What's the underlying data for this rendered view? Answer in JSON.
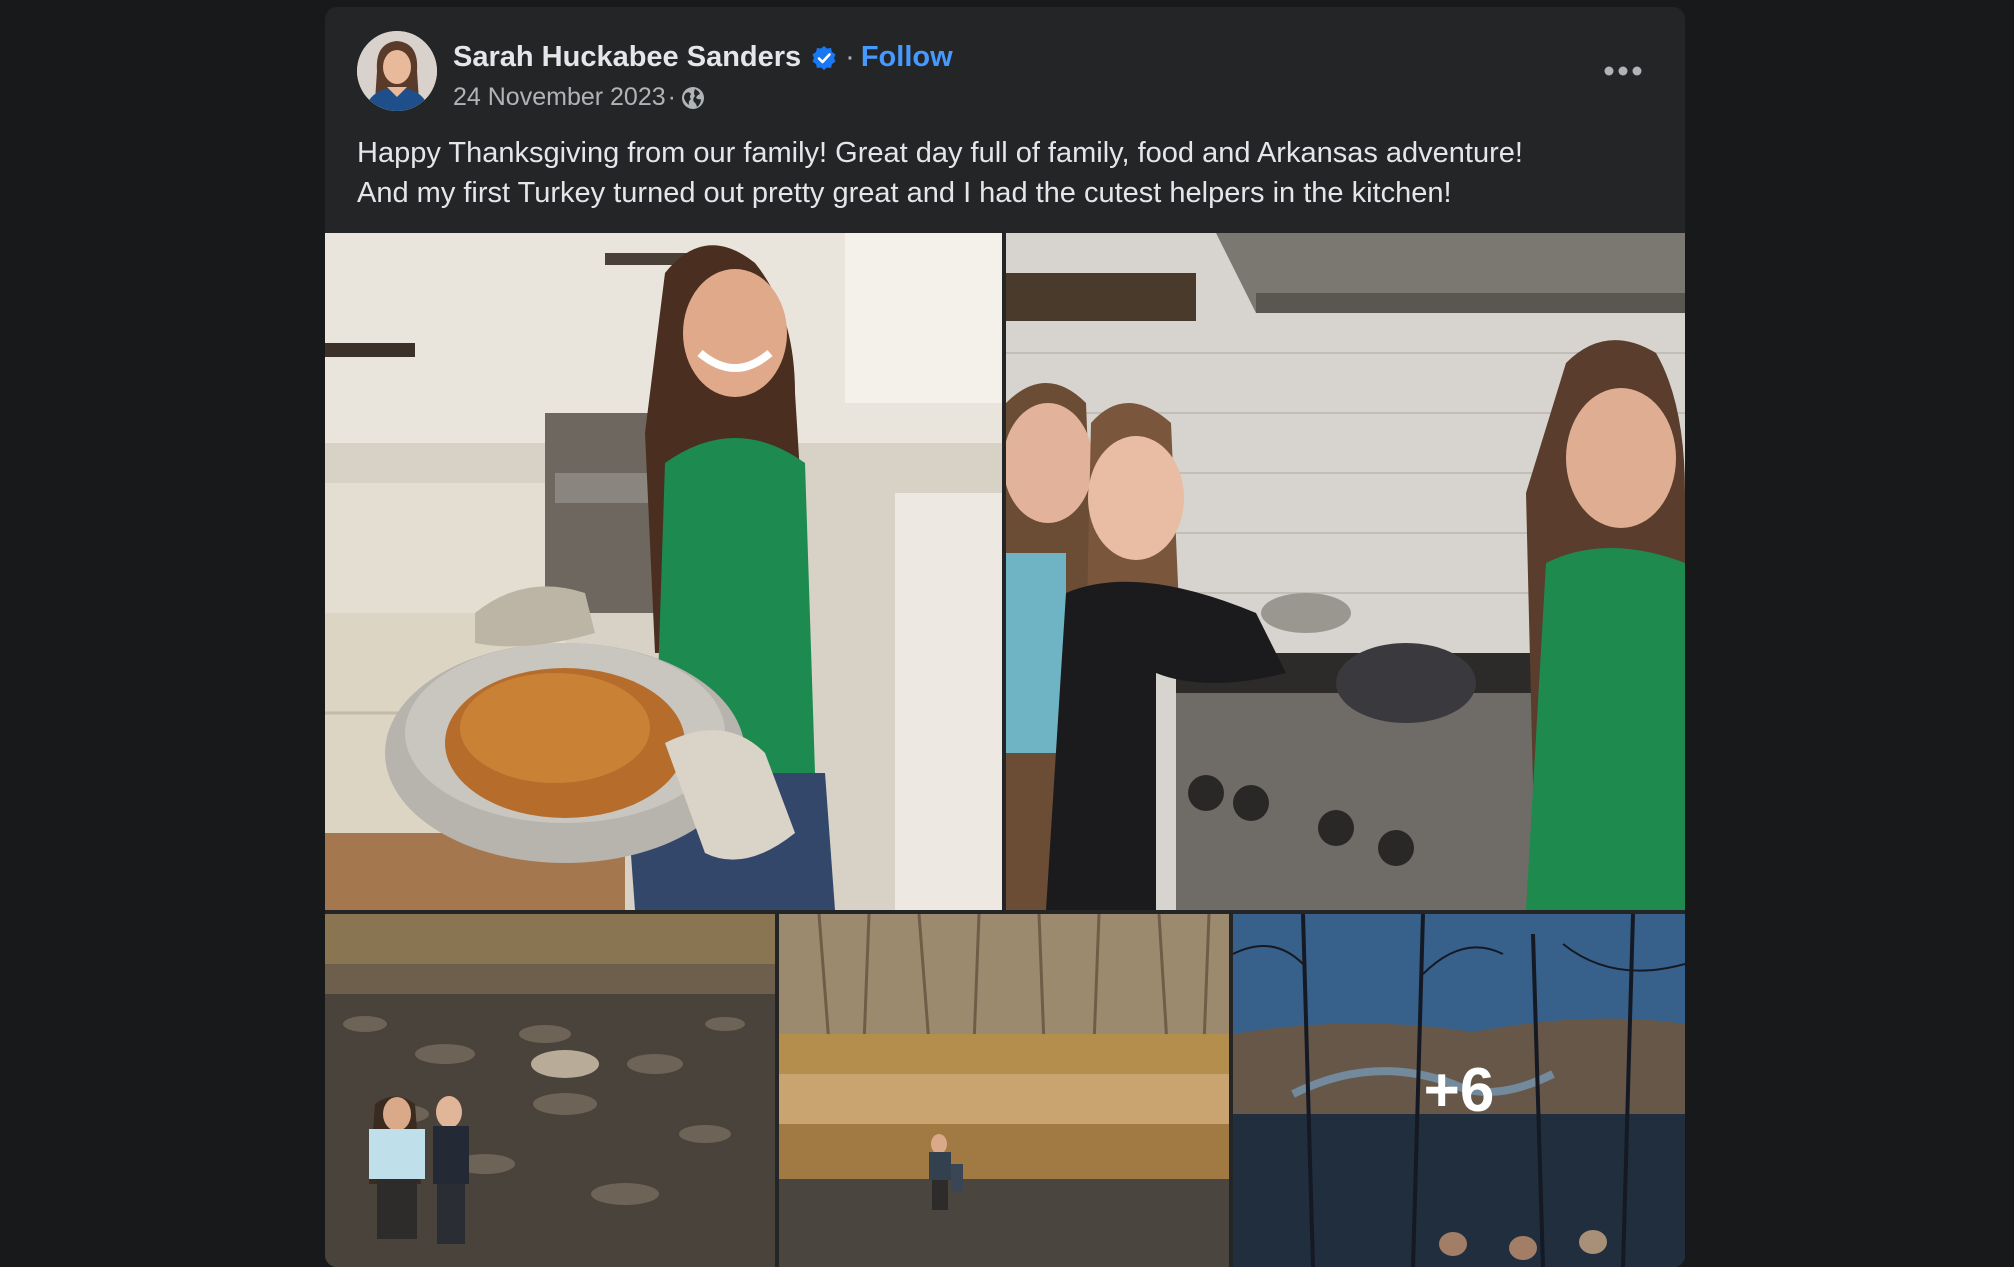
{
  "post": {
    "author": {
      "name": "Sarah Huckabee Sanders",
      "verified": true,
      "avatar_icon": "profile-photo"
    },
    "separator": "·",
    "follow_label": "Follow",
    "date": "24 November 2023",
    "date_separator": "·",
    "privacy_icon": "globe-icon",
    "more_icon": "more-options-icon",
    "text_lines": [
      "Happy Thanksgiving from our family! Great day full of family, food and Arkansas adventure!",
      "And my first Turkey turned out pretty great and I had the cutest helpers in the kitchen!"
    ],
    "photos": [
      {
        "subject": "woman holding roasted turkey in kitchen",
        "icon": "photo-turkey"
      },
      {
        "subject": "woman and two girls cooking at stove",
        "icon": "photo-kitchen-helpers"
      },
      {
        "subject": "woman and child on rocky lakeshore",
        "icon": "photo-lakeshore"
      },
      {
        "subject": "people walking by river with bare trees",
        "icon": "photo-river"
      },
      {
        "subject": "view over forested river valley",
        "icon": "photo-overlook"
      }
    ],
    "extra_photos_label": "+6",
    "colors": {
      "background": "#18191a",
      "card": "#242526",
      "text_primary": "#e4e6eb",
      "text_secondary": "#b0b3b8",
      "link": "#4599ff",
      "verified": "#1877f2"
    }
  }
}
